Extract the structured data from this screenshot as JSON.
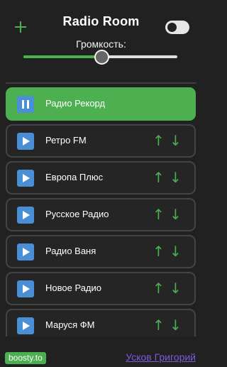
{
  "header": {
    "title": "Radio Room",
    "add_icon": "plus-icon",
    "theme_toggle": "off"
  },
  "volume": {
    "label": "Громкость:",
    "level": 0.5
  },
  "stations": [
    {
      "name": "Радио Рекорд",
      "state": "playing"
    },
    {
      "name": "Ретро FM",
      "state": "stopped"
    },
    {
      "name": "Европа Плюс",
      "state": "stopped"
    },
    {
      "name": "Русское Радио",
      "state": "stopped"
    },
    {
      "name": "Радио Ваня",
      "state": "stopped"
    },
    {
      "name": "Новое Радио",
      "state": "stopped"
    },
    {
      "name": "Маруся ФМ",
      "state": "stopped"
    }
  ],
  "arrows": {
    "up": "↑",
    "down": "↓"
  },
  "footer": {
    "boosty": "boosty.to",
    "author": "Усков Григорий"
  },
  "colors": {
    "background": "#212121",
    "accent": "#4caf50",
    "link": "#7b5bd9",
    "icon": "#4a8fd6"
  }
}
